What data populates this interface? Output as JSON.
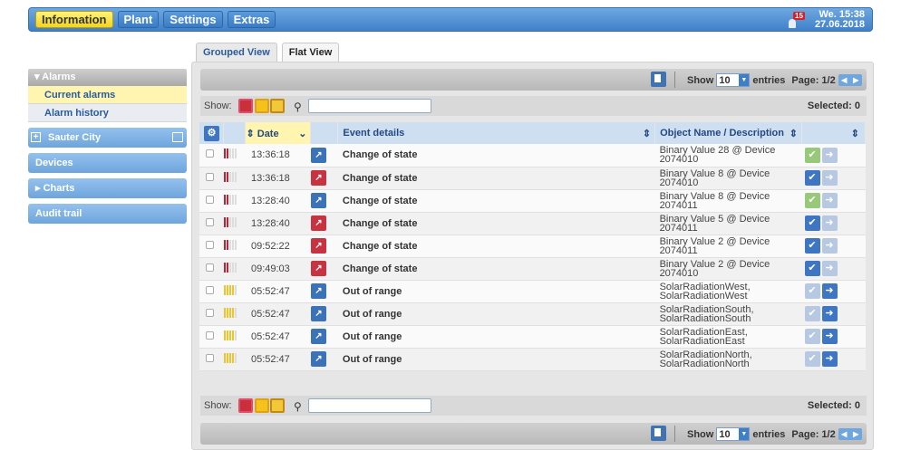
{
  "topbar": {
    "menu": [
      "Information",
      "Plant",
      "Settings",
      "Extras"
    ],
    "active_menu": "Information",
    "alarm_count": "15",
    "day_time": "We. 15:38",
    "date": "27.06.2018"
  },
  "sidebar": {
    "alarms_header": "Alarms",
    "alarm_items": [
      "Current alarms",
      "Alarm history"
    ],
    "buttons": [
      "Sauter City",
      "Devices",
      "Charts",
      "Audit trail"
    ]
  },
  "tabs": [
    "Grouped View",
    "Flat View"
  ],
  "active_tab": "Flat View",
  "pager": {
    "show_label": "Show",
    "entries_value": "10",
    "entries_label": "entries",
    "page_label": "Page: 1/2"
  },
  "toolbar": {
    "show_label": "Show:",
    "selected_label": "Selected: 0"
  },
  "table": {
    "columns": [
      "Date",
      "Event details",
      "Object Name / Description"
    ],
    "rows": [
      {
        "priority": "red",
        "time": "13:36:18",
        "event_color": "blue",
        "event": "Change of state",
        "object": "Binary Value 28 @ Device 2074010",
        "ack": "light",
        "arrow": "pale"
      },
      {
        "priority": "red",
        "time": "13:36:18",
        "event_color": "red",
        "event": "Change of state",
        "object": "Binary Value 8 @ Device 2074010",
        "ack": "blue",
        "arrow": "pale"
      },
      {
        "priority": "red",
        "time": "13:28:40",
        "event_color": "blue",
        "event": "Change of state",
        "object": "Binary Value 8 @ Device 2074011",
        "ack": "light",
        "arrow": "pale"
      },
      {
        "priority": "red",
        "time": "13:28:40",
        "event_color": "red",
        "event": "Change of state",
        "object": "Binary Value 5 @ Device 2074011",
        "ack": "blue",
        "arrow": "pale"
      },
      {
        "priority": "red",
        "time": "09:52:22",
        "event_color": "red",
        "event": "Change of state",
        "object": "Binary Value 2 @ Device 2074011",
        "ack": "blue",
        "arrow": "pale"
      },
      {
        "priority": "red",
        "time": "09:49:03",
        "event_color": "red",
        "event": "Change of state",
        "object": "Binary Value 2 @ Device 2074010",
        "ack": "blue",
        "arrow": "pale"
      },
      {
        "priority": "yellow",
        "time": "05:52:47",
        "event_color": "blue",
        "event": "Out of range",
        "object": "SolarRadiationWest, SolarRadiationWest",
        "ack": "pale",
        "arrow": "blue"
      },
      {
        "priority": "yellow",
        "time": "05:52:47",
        "event_color": "blue",
        "event": "Out of range",
        "object": "SolarRadiationSouth, SolarRadiationSouth",
        "ack": "pale",
        "arrow": "blue"
      },
      {
        "priority": "yellow",
        "time": "05:52:47",
        "event_color": "blue",
        "event": "Out of range",
        "object": "SolarRadiationEast, SolarRadiationEast",
        "ack": "pale",
        "arrow": "blue"
      },
      {
        "priority": "yellow",
        "time": "05:52:47",
        "event_color": "blue",
        "event": "Out of range",
        "object": "SolarRadiationNorth, SolarRadiationNorth",
        "ack": "pale",
        "arrow": "blue"
      }
    ]
  }
}
